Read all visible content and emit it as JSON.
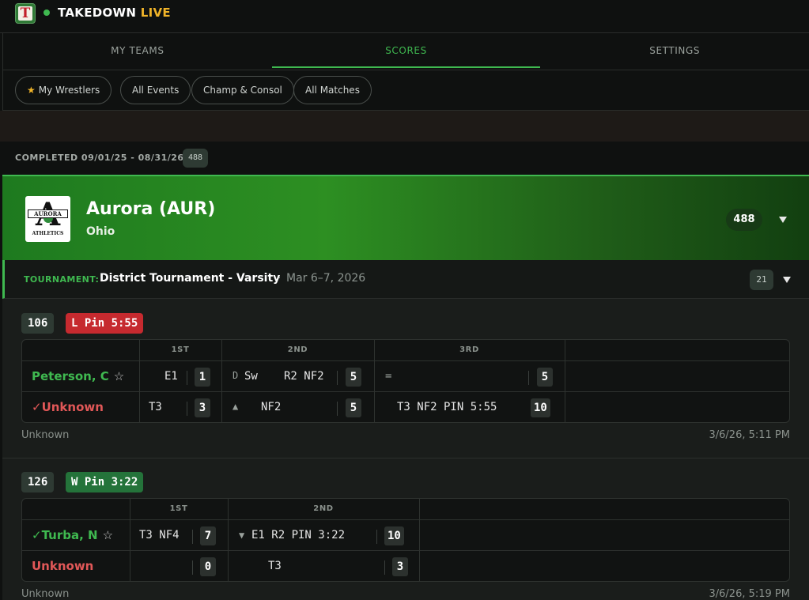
{
  "app": {
    "title_main": "TAKEDOWN",
    "title_accent": "LIVE",
    "logo_letter": "T",
    "accent_color": "#3fb950",
    "live_color": "#f0b429"
  },
  "nav": {
    "tabs": [
      {
        "label": "MY TEAMS"
      },
      {
        "label": "SCORES",
        "active": true
      },
      {
        "label": "SETTINGS"
      }
    ]
  },
  "filters": [
    {
      "label": "My Wrestlers",
      "icon": "star-icon"
    },
    {
      "label": "All Events"
    },
    {
      "label": "Champ & Consol"
    },
    {
      "label": "All Matches"
    }
  ],
  "completed": {
    "label": "COMPLETED 09/01/25 - 08/31/26",
    "count": "488"
  },
  "team": {
    "name": "Aurora (AUR)",
    "state": "Ohio",
    "count": "488",
    "logo": {
      "letter": "A",
      "band_text": "AURORA",
      "sub_text": "ATHLETICS"
    }
  },
  "tournament": {
    "label": "TOURNAMENT:",
    "name": "District Tournament - Varsity",
    "separator": "·",
    "date": "Mar 6–7, 2026",
    "count": "21"
  },
  "matches": [
    {
      "weight": "106",
      "result": "L Pin 5:55",
      "result_type": "loss",
      "periods": [
        "1ST",
        "2ND",
        "3RD"
      ],
      "wrestlers": [
        {
          "name": "Peterson, C",
          "color": "green",
          "star": "☆",
          "cells": [
            {
              "left": "",
              "right": "E1",
              "pts": "1"
            },
            {
              "prefix": "D",
              "left": "Sw",
              "right": "R2 NF2",
              "pts": "5"
            },
            {
              "prefix": "=",
              "left": "",
              "right": "",
              "pts": "5"
            }
          ]
        },
        {
          "name": "Unknown",
          "check": "✓",
          "color": "red",
          "cells": [
            {
              "left": "T3",
              "right": "",
              "pts": "3"
            },
            {
              "prefix": "▲",
              "left": "NF2",
              "right": "",
              "pts": "5"
            },
            {
              "left": "",
              "right": "T3 NF2 PIN 5:55",
              "pts": "10"
            }
          ]
        }
      ],
      "footer_left": "Unknown",
      "footer_right": "3/6/26, 5:11 PM"
    },
    {
      "weight": "126",
      "result": "W Pin 3:22",
      "result_type": "win",
      "periods": [
        "1ST",
        "2ND"
      ],
      "wrestlers": [
        {
          "name": "Turba, N",
          "check": "✓",
          "color": "green",
          "star": "☆",
          "cells": [
            {
              "left": "T3 NF4",
              "right": "",
              "pts": "7"
            },
            {
              "prefix": "▼",
              "left": "E1 R2 PIN 3:22",
              "right": "",
              "pts": "10"
            }
          ]
        },
        {
          "name": "Unknown",
          "color": "red",
          "cells": [
            {
              "left": "",
              "right": "",
              "pts": "0"
            },
            {
              "left": "T3",
              "right": "",
              "pts": "3"
            }
          ]
        }
      ],
      "footer_left": "Unknown",
      "footer_right": "3/6/26, 5:19 PM"
    }
  ]
}
